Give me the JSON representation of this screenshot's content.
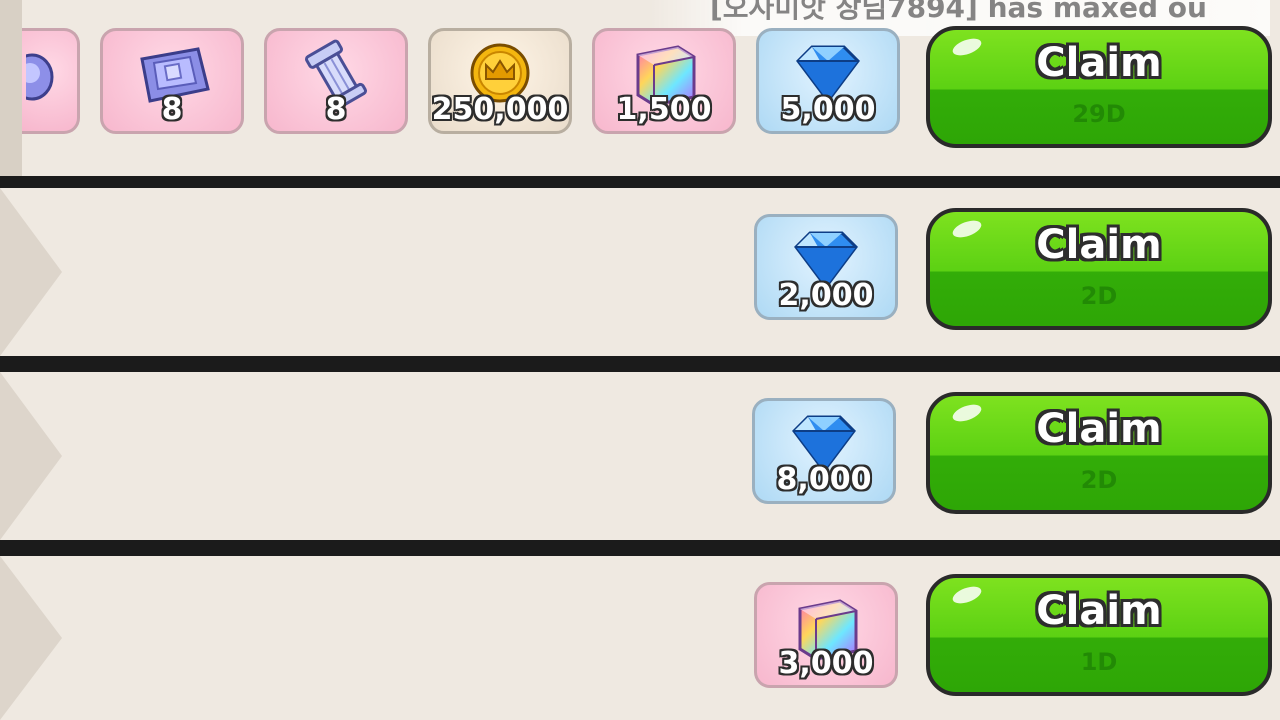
{
  "ticker": {
    "text": "[오자미앗 장님7894] has maxed ou"
  },
  "colors": {
    "row_bg": "#efe9e1",
    "divider": "#1b1b1b",
    "claim_green": "#5cd113",
    "claim_dark_green": "#2ea606",
    "days_text": "#228a05"
  },
  "rows": [
    {
      "items": [
        {
          "icon": "partial-crystal-icon",
          "qty": ""
        },
        {
          "icon": "soulstone-tablet-icon",
          "qty": "8"
        },
        {
          "icon": "pillar-piece-icon",
          "qty": "8"
        },
        {
          "icon": "gold-coin-crown-icon",
          "qty": "250,000"
        },
        {
          "icon": "rainbow-cube-icon",
          "qty": "1,500"
        },
        {
          "icon": "crystal-gem-icon",
          "qty": "5,000"
        }
      ],
      "claim": {
        "label": "Claim",
        "days": "29D"
      }
    },
    {
      "items": [
        {
          "icon": "crystal-gem-icon",
          "qty": "2,000"
        }
      ],
      "claim": {
        "label": "Claim",
        "days": "2D"
      }
    },
    {
      "items": [
        {
          "icon": "crystal-gem-icon",
          "qty": "8,000"
        }
      ],
      "claim": {
        "label": "Claim",
        "days": "2D"
      }
    },
    {
      "items": [
        {
          "icon": "rainbow-cube-icon",
          "qty": "3,000"
        }
      ],
      "claim": {
        "label": "Claim",
        "days": "1D"
      }
    }
  ]
}
